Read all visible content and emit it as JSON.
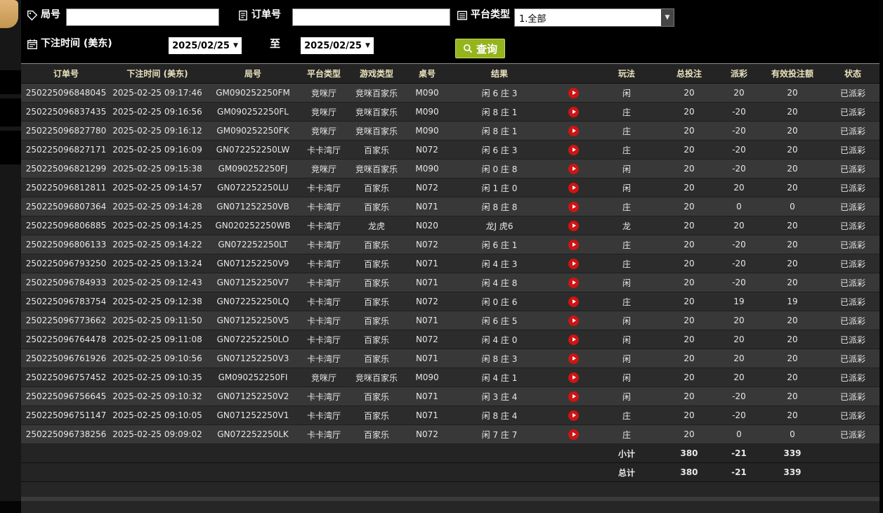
{
  "filters": {
    "round": {
      "label": "局号",
      "value": "",
      "icon": "tag-icon"
    },
    "order": {
      "label": "订单号",
      "value": "",
      "icon": "document-icon"
    },
    "platform": {
      "label": "平台类型",
      "value": "1.全部",
      "icon": "list-icon"
    },
    "bet_time": {
      "label": "下注时间 (美东)",
      "icon": "calendar-icon"
    },
    "date_from": "2025/02/25",
    "to_label": "至",
    "date_to": "2025/02/25",
    "query_button": "查询"
  },
  "icons": {
    "dropdown_arrow": "▼"
  },
  "colors": {
    "payout_positive": "#b92525",
    "payout_negative": "#06a752",
    "status_paid": "#04b04e",
    "summary_yellow": "#f2f200",
    "query_button_bg": "#95b41d",
    "header_text": "#e9e2bd",
    "sidebar_tab_tan": "#d2a467"
  },
  "table": {
    "headers": [
      "订单号",
      "下注时间 (美东)",
      "局号",
      "平台类型",
      "游戏类型",
      "桌号",
      "结果",
      "",
      "玩法",
      "总投注",
      "派彩",
      "有效投注额",
      "状态"
    ],
    "rows": [
      {
        "order": "250225096848045",
        "time": "2025-02-25 09:17:46",
        "round": "GM090252250FM",
        "platform": "竞咪厅",
        "game": "竞咪百家乐",
        "table_no": "M090",
        "result": "闲 6 庄 3",
        "play": "闲",
        "total_bet": "20",
        "payout": "20",
        "payout_class": "pos",
        "valid_bet": "20",
        "status": "已派彩"
      },
      {
        "order": "250225096837435",
        "time": "2025-02-25 09:16:56",
        "round": "GM090252250FL",
        "platform": "竞咪厅",
        "game": "竞咪百家乐",
        "table_no": "M090",
        "result": "闲 8 庄 1",
        "play": "庄",
        "total_bet": "20",
        "payout": "-20",
        "payout_class": "neg",
        "valid_bet": "20",
        "status": "已派彩"
      },
      {
        "order": "250225096827780",
        "time": "2025-02-25 09:16:12",
        "round": "GM090252250FK",
        "platform": "竞咪厅",
        "game": "竞咪百家乐",
        "table_no": "M090",
        "result": "闲 8 庄 1",
        "play": "庄",
        "total_bet": "20",
        "payout": "-20",
        "payout_class": "neg",
        "valid_bet": "20",
        "status": "已派彩"
      },
      {
        "order": "250225096827171",
        "time": "2025-02-25 09:16:09",
        "round": "GN072252250LW",
        "platform": "卡卡湾厅",
        "game": "百家乐",
        "table_no": "N072",
        "result": "闲 6 庄 3",
        "play": "庄",
        "total_bet": "20",
        "payout": "-20",
        "payout_class": "neg",
        "valid_bet": "20",
        "status": "已派彩"
      },
      {
        "order": "250225096821299",
        "time": "2025-02-25 09:15:38",
        "round": "GM090252250FJ",
        "platform": "竞咪厅",
        "game": "竞咪百家乐",
        "table_no": "M090",
        "result": "闲 0 庄 8",
        "play": "闲",
        "total_bet": "20",
        "payout": "-20",
        "payout_class": "neg",
        "valid_bet": "20",
        "status": "已派彩"
      },
      {
        "order": "250225096812811",
        "time": "2025-02-25 09:14:57",
        "round": "GN072252250LU",
        "platform": "卡卡湾厅",
        "game": "百家乐",
        "table_no": "N072",
        "result": "闲 1 庄 0",
        "play": "闲",
        "total_bet": "20",
        "payout": "20",
        "payout_class": "pos",
        "valid_bet": "20",
        "status": "已派彩"
      },
      {
        "order": "250225096807364",
        "time": "2025-02-25 09:14:28",
        "round": "GN071252250VB",
        "platform": "卡卡湾厅",
        "game": "百家乐",
        "table_no": "N071",
        "result": "闲 8 庄 8",
        "play": "庄",
        "total_bet": "20",
        "payout": "0",
        "payout_class": "zero",
        "valid_bet": "0",
        "status": "已派彩"
      },
      {
        "order": "250225096806885",
        "time": "2025-02-25 09:14:25",
        "round": "GN020252250WB",
        "platform": "卡卡湾厅",
        "game": "龙虎",
        "table_no": "N020",
        "result": "龙J 虎6",
        "play": "龙",
        "total_bet": "20",
        "payout": "20",
        "payout_class": "pos",
        "valid_bet": "20",
        "status": "已派彩"
      },
      {
        "order": "250225096806133",
        "time": "2025-02-25 09:14:22",
        "round": "GN072252250LT",
        "platform": "卡卡湾厅",
        "game": "百家乐",
        "table_no": "N072",
        "result": "闲 6 庄 1",
        "play": "庄",
        "total_bet": "20",
        "payout": "-20",
        "payout_class": "neg",
        "valid_bet": "20",
        "status": "已派彩"
      },
      {
        "order": "250225096793250",
        "time": "2025-02-25 09:13:24",
        "round": "GN071252250V9",
        "platform": "卡卡湾厅",
        "game": "百家乐",
        "table_no": "N071",
        "result": "闲 4 庄 3",
        "play": "庄",
        "total_bet": "20",
        "payout": "-20",
        "payout_class": "neg",
        "valid_bet": "20",
        "status": "已派彩"
      },
      {
        "order": "250225096784933",
        "time": "2025-02-25 09:12:43",
        "round": "GN071252250V7",
        "platform": "卡卡湾厅",
        "game": "百家乐",
        "table_no": "N071",
        "result": "闲 4 庄 8",
        "play": "闲",
        "total_bet": "20",
        "payout": "-20",
        "payout_class": "neg",
        "valid_bet": "20",
        "status": "已派彩"
      },
      {
        "order": "250225096783754",
        "time": "2025-02-25 09:12:38",
        "round": "GN072252250LQ",
        "platform": "卡卡湾厅",
        "game": "百家乐",
        "table_no": "N072",
        "result": "闲 0 庄 6",
        "play": "庄",
        "total_bet": "20",
        "payout": "19",
        "payout_class": "pos",
        "valid_bet": "19",
        "status": "已派彩"
      },
      {
        "order": "250225096773662",
        "time": "2025-02-25 09:11:50",
        "round": "GN071252250V5",
        "platform": "卡卡湾厅",
        "game": "百家乐",
        "table_no": "N071",
        "result": "闲 6 庄 5",
        "play": "闲",
        "total_bet": "20",
        "payout": "20",
        "payout_class": "pos",
        "valid_bet": "20",
        "status": "已派彩"
      },
      {
        "order": "250225096764478",
        "time": "2025-02-25 09:11:08",
        "round": "GN072252250LO",
        "platform": "卡卡湾厅",
        "game": "百家乐",
        "table_no": "N072",
        "result": "闲 4 庄 0",
        "play": "闲",
        "total_bet": "20",
        "payout": "20",
        "payout_class": "pos",
        "valid_bet": "20",
        "status": "已派彩"
      },
      {
        "order": "250225096761926",
        "time": "2025-02-25 09:10:56",
        "round": "GN071252250V3",
        "platform": "卡卡湾厅",
        "game": "百家乐",
        "table_no": "N071",
        "result": "闲 8 庄 3",
        "play": "闲",
        "total_bet": "20",
        "payout": "20",
        "payout_class": "pos",
        "valid_bet": "20",
        "status": "已派彩"
      },
      {
        "order": "250225096757452",
        "time": "2025-02-25 09:10:35",
        "round": "GM090252250FI",
        "platform": "竞咪厅",
        "game": "竞咪百家乐",
        "table_no": "M090",
        "result": "闲 4 庄 1",
        "play": "闲",
        "total_bet": "20",
        "payout": "20",
        "payout_class": "pos",
        "valid_bet": "20",
        "status": "已派彩"
      },
      {
        "order": "250225096756645",
        "time": "2025-02-25 09:10:32",
        "round": "GN071252250V2",
        "platform": "卡卡湾厅",
        "game": "百家乐",
        "table_no": "N071",
        "result": "闲 3 庄 4",
        "play": "闲",
        "total_bet": "20",
        "payout": "-20",
        "payout_class": "neg",
        "valid_bet": "20",
        "status": "已派彩"
      },
      {
        "order": "250225096751147",
        "time": "2025-02-25 09:10:05",
        "round": "GN071252250V1",
        "platform": "卡卡湾厅",
        "game": "百家乐",
        "table_no": "N071",
        "result": "闲 8 庄 4",
        "play": "庄",
        "total_bet": "20",
        "payout": "-20",
        "payout_class": "neg",
        "valid_bet": "20",
        "status": "已派彩"
      },
      {
        "order": "250225096738256",
        "time": "2025-02-25 09:09:02",
        "round": "GN072252250LK",
        "platform": "卡卡湾厅",
        "game": "百家乐",
        "table_no": "N072",
        "result": "闲 7 庄 7",
        "play": "庄",
        "total_bet": "20",
        "payout": "0",
        "payout_class": "zero",
        "valid_bet": "0",
        "status": "已派彩"
      }
    ],
    "subtotal": {
      "label": "小计",
      "total_bet": "380",
      "payout": "-21",
      "valid_bet": "339"
    },
    "grand_total": {
      "label": "总计",
      "total_bet": "380",
      "payout": "-21",
      "valid_bet": "339"
    }
  }
}
